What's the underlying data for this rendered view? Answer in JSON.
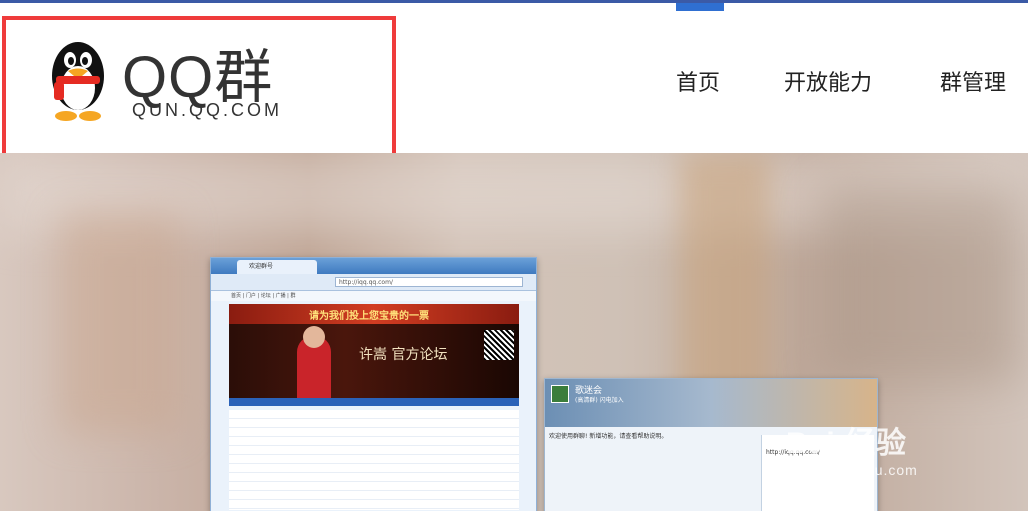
{
  "header": {
    "logo_text": "QQ群",
    "logo_domain": "QUN.QQ.COM",
    "nav": [
      {
        "label": "首页"
      },
      {
        "label": "开放能力"
      },
      {
        "label": "群管理"
      }
    ]
  },
  "hero": {
    "browser": {
      "tab_title": "欢迎群号",
      "url": "http://iqq.qq.com/",
      "banner_text": "请为我们投上您宝贵的一票",
      "artist_name": "许嵩 官方论坛",
      "nav_text": "首页 | 门户 | 论坛 | 广播 | 群"
    },
    "chat": {
      "title": "歌迷会",
      "subtitle": "(高清群) 闪电加入",
      "notice": "欢迎使用群聊! 新增功能，请查看帮助说明。",
      "side_url": "http://iqq.qq.com/"
    },
    "watermark": {
      "main": "Bai 经验",
      "sub": "jingyan.baidu.com"
    }
  },
  "colors": {
    "accent_bar": "#3b5aa6",
    "highlight_border": "#ef3b3b"
  }
}
